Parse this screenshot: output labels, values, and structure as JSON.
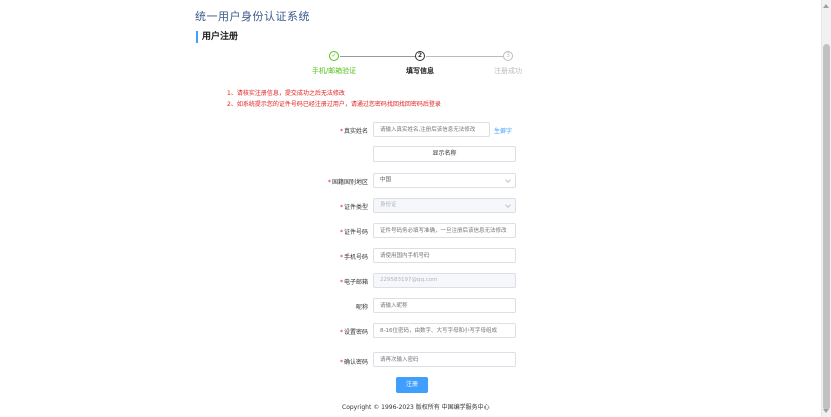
{
  "app_title": "统一用户身份认证系统",
  "section_heading": "用户注册",
  "steps": [
    {
      "label": "手机/邮箱验证",
      "marker": "✓",
      "state": "done"
    },
    {
      "label": "填写信息",
      "marker": "2",
      "state": "active"
    },
    {
      "label": "注册成功",
      "marker": "3",
      "state": "pending"
    }
  ],
  "notices": [
    "1、请核实注册信息，提交成功之后无法修改",
    "2、如系统提示您的证件号码已经注册过用户，请通过您密码找回找回密码后登录"
  ],
  "form": {
    "real_name": {
      "label": "真实姓名",
      "placeholder": "请输入真实姓名,注册后该信息无法修改",
      "gen_link": "生僻字"
    },
    "display_name_button": "显示名称",
    "country": {
      "label": "国籍国别地区",
      "value": "中国"
    },
    "id_type": {
      "label": "证件类型",
      "value": "身份证"
    },
    "id_number": {
      "label": "证件号码",
      "placeholder": "证件号码务必填写准确，一旦注册后该信息无法修改"
    },
    "phone": {
      "label": "手机号码",
      "placeholder": "请使用国内手机号码"
    },
    "email": {
      "label": "电子邮箱",
      "value": "229583197@qq.com"
    },
    "nickname": {
      "label": "昵称",
      "placeholder": "请输入昵称"
    },
    "password": {
      "label": "设置密码",
      "placeholder": "8-16位密码，由数字、大写字母和小写字母组成"
    },
    "confirm_password": {
      "label": "确认密码",
      "placeholder": "请再次输入密码"
    }
  },
  "submit_label": "注册",
  "footer": "Copyright © 1996-2023 版权所有 中国编学服务中心",
  "colors": {
    "accent": "#409eff",
    "done": "#52c41a",
    "error": "#e02020"
  }
}
